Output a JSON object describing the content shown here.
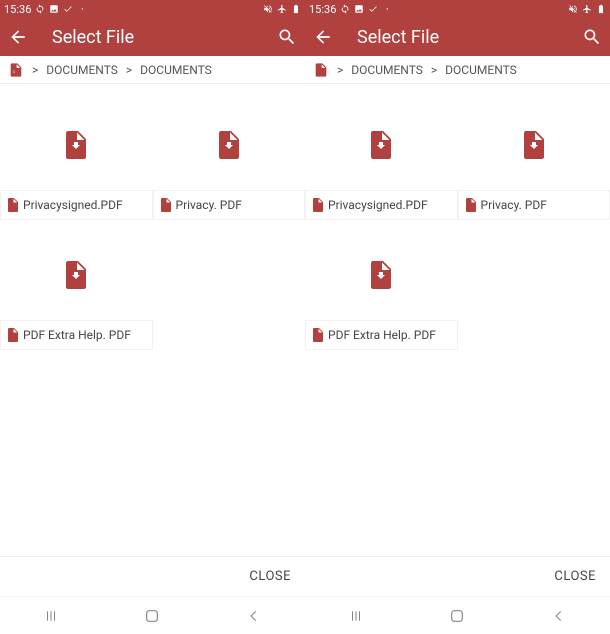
{
  "status": {
    "time": "15:36",
    "left_icons": [
      "sync",
      "image",
      "check"
    ],
    "right_icons": [
      "mute",
      "airplane",
      "battery"
    ]
  },
  "app": {
    "title": "Select File"
  },
  "breadcrumb": {
    "segment1": "DOCUMENTS",
    "segment2": "DOCUMENTS",
    "sep": ">"
  },
  "files": [
    {
      "name": "Privacysigned.PDF"
    },
    {
      "name": "Privacy. PDF"
    },
    {
      "name": "PDF Extra Help. PDF"
    }
  ],
  "actions": {
    "close": "CLOSE"
  },
  "colors": {
    "accent": "#b0413e"
  }
}
